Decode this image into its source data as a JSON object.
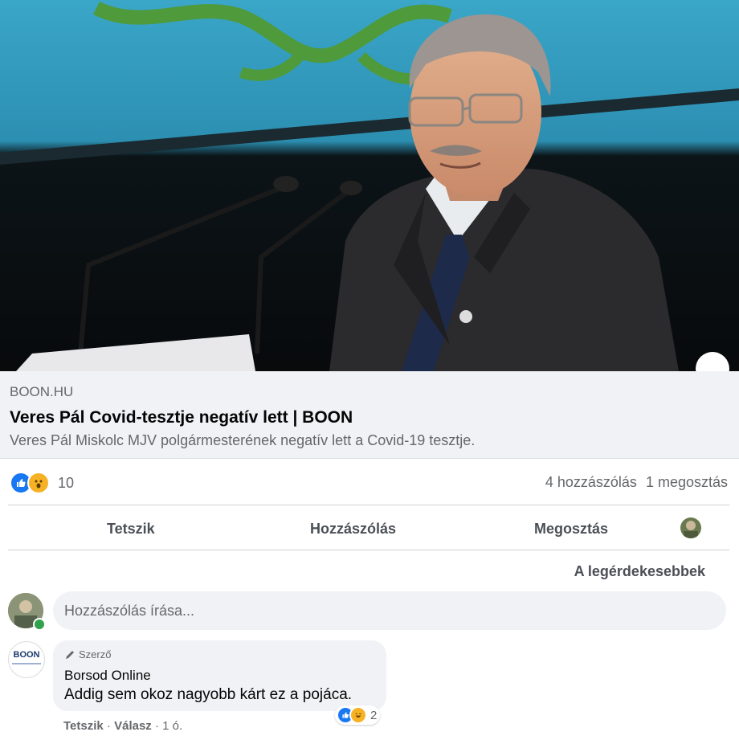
{
  "link_preview": {
    "domain": "BOON.HU",
    "title": "Veres Pál Covid-tesztje negatív lett | BOON",
    "description": "Veres Pál Miskolc MJV polgármesterének negatív lett a Covid-19 tesztje."
  },
  "reactions": {
    "count": "10",
    "icons": [
      "like-icon",
      "wow-icon"
    ]
  },
  "counts": {
    "comments": "4 hozzászólás",
    "shares": "1 megosztás"
  },
  "actions": {
    "like": "Tetszik",
    "comment": "Hozzászólás",
    "share": "Megosztás"
  },
  "sort": {
    "label": "A legérdekesebbek"
  },
  "comment_box": {
    "placeholder": "Hozzászólás írása..."
  },
  "comment": {
    "badge": "Szerző",
    "author": "Borsod Online",
    "text": "Addig sem okoz nagyobb kárt ez a pojáca.",
    "reaction_count": "2",
    "like_label": "Tetszik",
    "reply_label": "Válasz",
    "time": "1 ó.",
    "avatar_text": "BOON"
  },
  "colors": {
    "accent": "#1877f2",
    "background": "#ffffff",
    "preview_bg": "#f0f2f5",
    "muted_text": "#65676b"
  }
}
